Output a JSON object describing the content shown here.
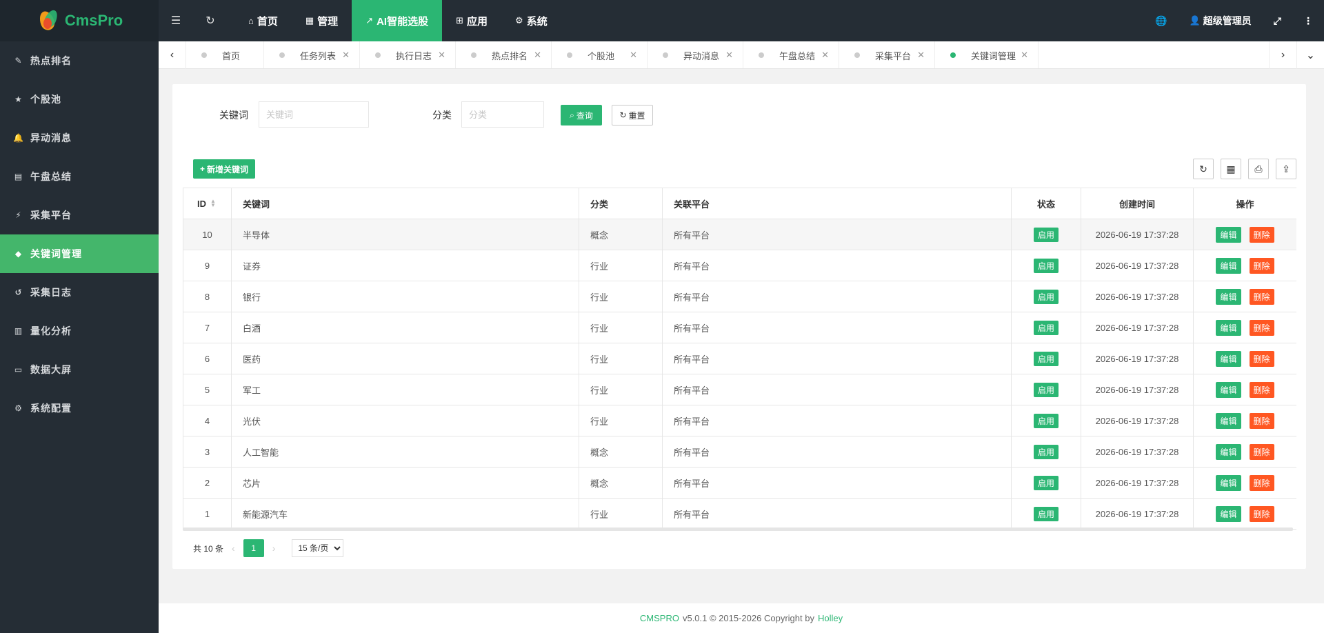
{
  "app": {
    "logo_text": "CmsPro"
  },
  "sidebar": {
    "items": [
      {
        "label": "热点排名",
        "icon": "brush-icon",
        "glyph": "✎"
      },
      {
        "label": "个股池",
        "icon": "star-icon",
        "glyph": "★"
      },
      {
        "label": "异动消息",
        "icon": "bell-icon",
        "glyph": "🔔"
      },
      {
        "label": "午盘总结",
        "icon": "file-icon",
        "glyph": "▤"
      },
      {
        "label": "采集平台",
        "icon": "plug-icon",
        "glyph": "⚡"
      },
      {
        "label": "关键词管理",
        "icon": "tags-icon",
        "glyph": "◆"
      },
      {
        "label": "采集日志",
        "icon": "history-icon",
        "glyph": "↺"
      },
      {
        "label": "量化分析",
        "icon": "bar-chart-icon",
        "glyph": "▥"
      },
      {
        "label": "数据大屏",
        "icon": "desktop-icon",
        "glyph": "▭"
      },
      {
        "label": "系统配置",
        "icon": "gear-icon",
        "glyph": "⚙"
      }
    ],
    "active_index": 5
  },
  "header": {
    "nav": [
      {
        "label": "首页",
        "glyph": "⌂"
      },
      {
        "label": "管理",
        "glyph": "▦"
      },
      {
        "label": "AI智能选股",
        "glyph": "↗"
      },
      {
        "label": "应用",
        "glyph": "⊞"
      },
      {
        "label": "系统",
        "glyph": "⚙"
      }
    ],
    "active_nav": 2,
    "user": "超级管理员"
  },
  "tabs": [
    {
      "label": "首页",
      "closable": false
    },
    {
      "label": "任务列表",
      "closable": true
    },
    {
      "label": "执行日志",
      "closable": true
    },
    {
      "label": "热点排名",
      "closable": true
    },
    {
      "label": "个股池",
      "closable": true
    },
    {
      "label": "异动消息",
      "closable": true
    },
    {
      "label": "午盘总结",
      "closable": true
    },
    {
      "label": "采集平台",
      "closable": true
    },
    {
      "label": "关键词管理",
      "closable": true,
      "active": true
    }
  ],
  "search": {
    "keyword_label": "关键词",
    "keyword_placeholder": "关键词",
    "category_label": "分类",
    "category_placeholder": "分类",
    "query_label": "查询",
    "reset_label": "重置"
  },
  "toolbar": {
    "add_label": "新增关键词"
  },
  "table": {
    "headers": {
      "id": "ID",
      "keyword": "关键词",
      "category": "分类",
      "platform": "关联平台",
      "status": "状态",
      "created": "创建时间",
      "actions": "操作"
    },
    "edit_label": "编辑",
    "delete_label": "删除",
    "rows": [
      {
        "id": "10",
        "keyword": "半导体",
        "category": "概念",
        "platform": "所有平台",
        "status": "启用",
        "created": "2026-06-19 17:37:28"
      },
      {
        "id": "9",
        "keyword": "证券",
        "category": "行业",
        "platform": "所有平台",
        "status": "启用",
        "created": "2026-06-19 17:37:28"
      },
      {
        "id": "8",
        "keyword": "银行",
        "category": "行业",
        "platform": "所有平台",
        "status": "启用",
        "created": "2026-06-19 17:37:28"
      },
      {
        "id": "7",
        "keyword": "白酒",
        "category": "行业",
        "platform": "所有平台",
        "status": "启用",
        "created": "2026-06-19 17:37:28"
      },
      {
        "id": "6",
        "keyword": "医药",
        "category": "行业",
        "platform": "所有平台",
        "status": "启用",
        "created": "2026-06-19 17:37:28"
      },
      {
        "id": "5",
        "keyword": "军工",
        "category": "行业",
        "platform": "所有平台",
        "status": "启用",
        "created": "2026-06-19 17:37:28"
      },
      {
        "id": "4",
        "keyword": "光伏",
        "category": "行业",
        "platform": "所有平台",
        "status": "启用",
        "created": "2026-06-19 17:37:28"
      },
      {
        "id": "3",
        "keyword": "人工智能",
        "category": "概念",
        "platform": "所有平台",
        "status": "启用",
        "created": "2026-06-19 17:37:28"
      },
      {
        "id": "2",
        "keyword": "芯片",
        "category": "概念",
        "platform": "所有平台",
        "status": "启用",
        "created": "2026-06-19 17:37:28"
      },
      {
        "id": "1",
        "keyword": "新能源汽车",
        "category": "行业",
        "platform": "所有平台",
        "status": "启用",
        "created": "2026-06-19 17:37:28"
      }
    ]
  },
  "pager": {
    "total": "共 10 条",
    "current": "1",
    "page_size": "15 条/页"
  },
  "footer": {
    "brand": "CMSPRO",
    "text": "v5.0.1 © 2015-2026 Copyright by",
    "author": "Holley"
  },
  "colors": {
    "accent": "#2bb673",
    "danger": "#ff5722",
    "sidebar": "#252d35"
  }
}
